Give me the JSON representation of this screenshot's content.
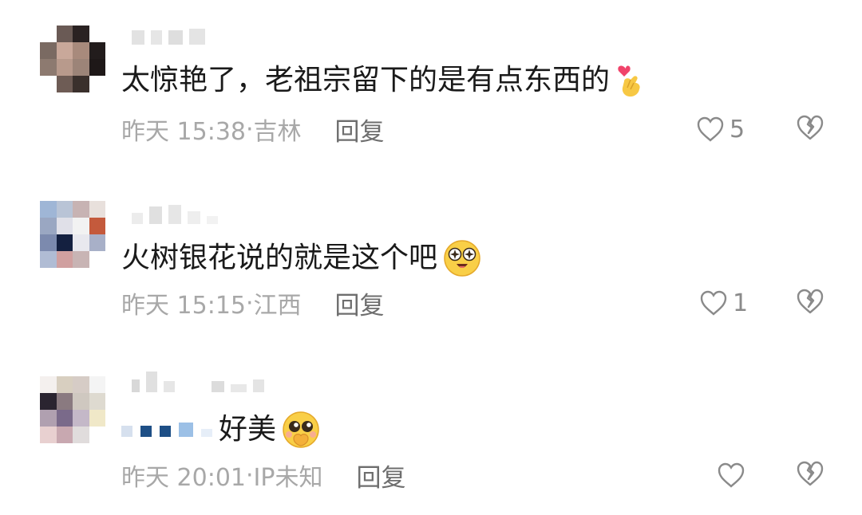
{
  "comments": [
    {
      "text": "太惊艳了，老祖宗留下的是有点东西的",
      "emoji": "finger-heart-icon",
      "time": "昨天 15:38",
      "location": "吉林",
      "reply_label": "回复",
      "likes": "5"
    },
    {
      "text": "火树银花说的就是这个吧",
      "emoji": "starry-eyes-icon",
      "time": "昨天 15:15",
      "location": "江西",
      "reply_label": "回复",
      "likes": "1"
    },
    {
      "text": "好美",
      "emoji": "pleading-face-icon",
      "time": "昨天 20:01",
      "location": "IP未知",
      "reply_label": "回复",
      "likes": ""
    }
  ],
  "colors": {
    "text": "#1a1a1a",
    "meta": "#a8a8a8",
    "reply": "#6e6e6e",
    "icon": "#8a8a8a"
  }
}
